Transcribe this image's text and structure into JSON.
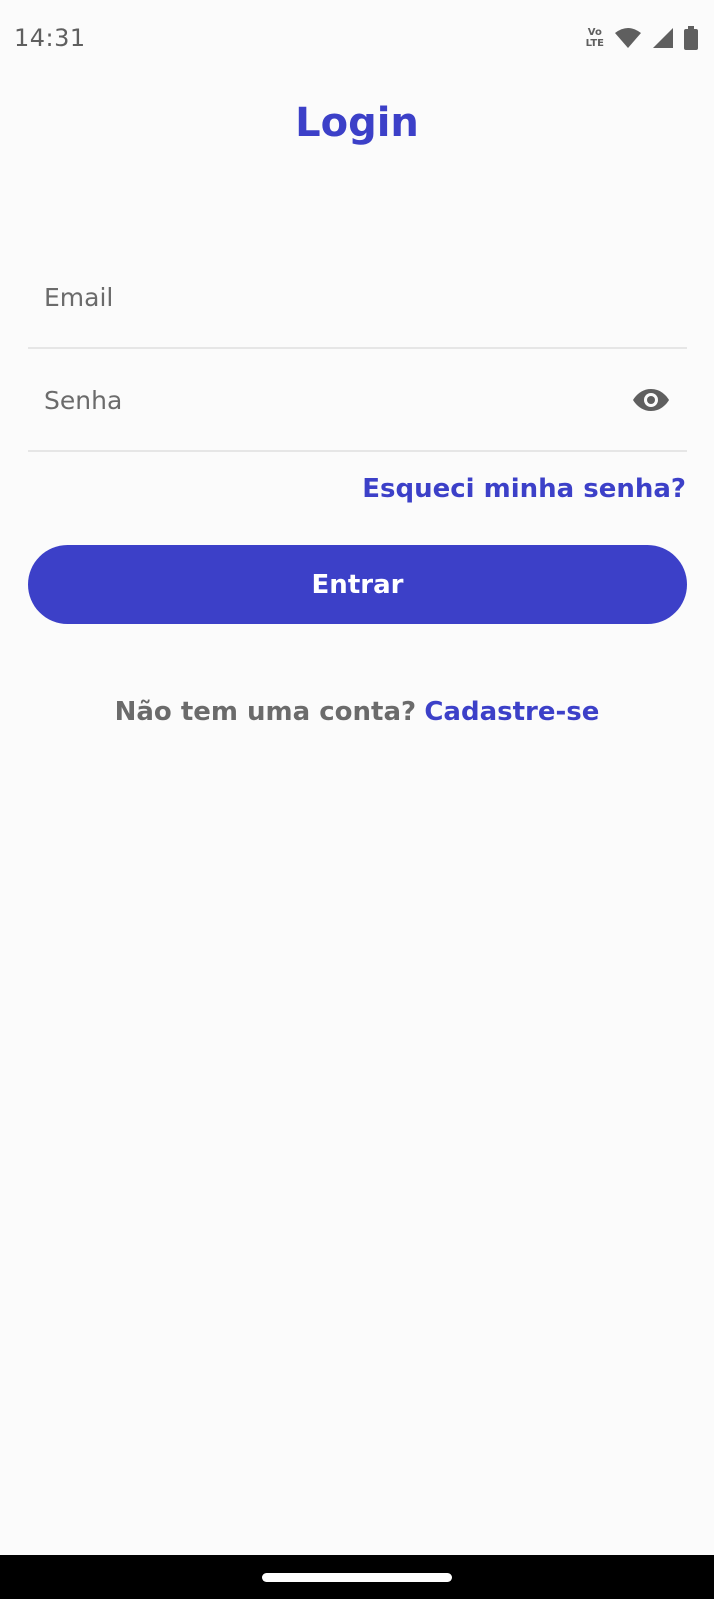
{
  "status_bar": {
    "time": "14:31",
    "volte_top": "Vo",
    "volte_bottom": "LTE",
    "icons": [
      "volte-icon",
      "wifi-icon",
      "signal-icon",
      "battery-icon"
    ]
  },
  "title": "Login",
  "form": {
    "email_placeholder": "Email",
    "password_placeholder": "Senha",
    "password_toggle_icon": "eye-icon",
    "forgot_link": "Esqueci minha senha?",
    "submit_label": "Entrar"
  },
  "signup": {
    "prompt": "Não tem uma conta?",
    "link": "Cadastre-se"
  },
  "colors": {
    "accent": "#3c40c8",
    "text_muted": "#6b6b6b",
    "background": "#fbfbfb",
    "divider": "#e6e6e6"
  }
}
